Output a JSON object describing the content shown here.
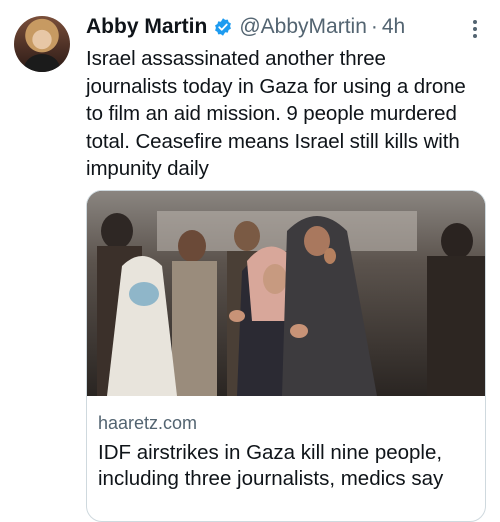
{
  "author": {
    "name": "Abby Martin",
    "handle": "@AbbyMartin",
    "separator": "·",
    "time": "4h",
    "avatar_icon": "profile-photo",
    "verified_icon": "verified-badge-icon",
    "verified_color": "#1d9bf0"
  },
  "tweet": {
    "lines": [
      "Israel assassinated another three",
      "journalists today in Gaza for using a drone",
      "to film an aid mission. 9 people murdered",
      "total. Ceasefire means Israel still kills with",
      "impunity daily"
    ]
  },
  "card": {
    "domain": "haaretz.com",
    "title_lines": [
      "IDF airstrikes in Gaza kill nine people,",
      "including three journalists, medics say"
    ],
    "image_description_icon": "news-photo"
  },
  "menu": {
    "more_icon": "more-vertical-icon"
  }
}
